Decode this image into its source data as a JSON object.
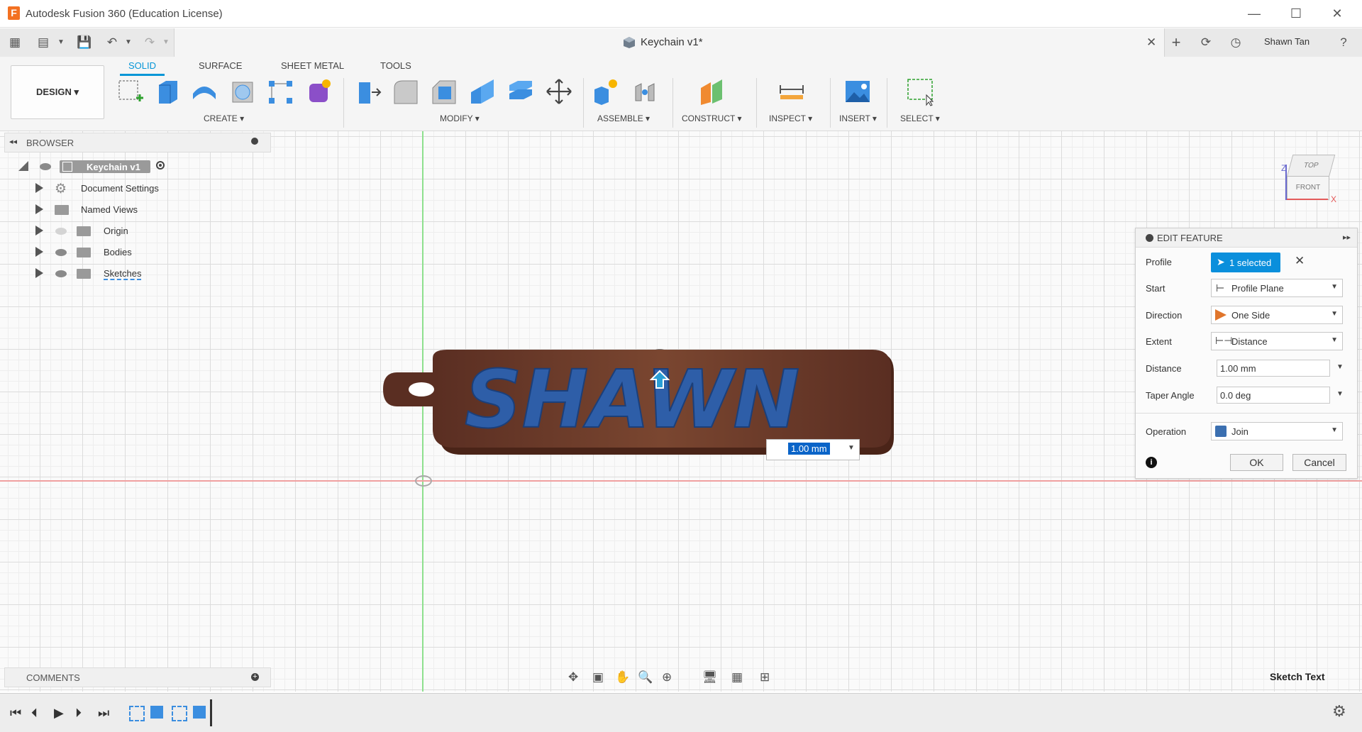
{
  "app": {
    "title": "Autodesk Fusion 360 (Education License)",
    "logo_letter": "F",
    "user": "Shawn Tan",
    "doc_title": "Keychain v1*"
  },
  "ribbon": {
    "tabs": [
      "SOLID",
      "SURFACE",
      "SHEET METAL",
      "TOOLS"
    ],
    "active_tab": "SOLID",
    "workspace": "DESIGN ▾",
    "groups": [
      "CREATE ▾",
      "MODIFY ▾",
      "ASSEMBLE ▾",
      "CONSTRUCT ▾",
      "INSPECT ▾",
      "INSERT ▾",
      "SELECT ▾"
    ]
  },
  "browser": {
    "title": "BROWSER",
    "root": "Keychain v1",
    "items": [
      "Document Settings",
      "Named Views",
      "Origin",
      "Bodies",
      "Sketches"
    ]
  },
  "viewcube": {
    "top": "TOP",
    "front": "FRONT",
    "axis_x": "X",
    "axis_z": "Z"
  },
  "model": {
    "text": "SHAWN",
    "dimension": "1.00 mm"
  },
  "edit_feature": {
    "title": "EDIT FEATURE",
    "rows": {
      "profile_label": "Profile",
      "profile_value": "1 selected",
      "start_label": "Start",
      "start_value": "Profile Plane",
      "direction_label": "Direction",
      "direction_value": "One Side",
      "extent_label": "Extent",
      "extent_value": "Distance",
      "distance_label": "Distance",
      "distance_value": "1.00 mm",
      "taper_label": "Taper Angle",
      "taper_value": "0.0 deg",
      "operation_label": "Operation",
      "operation_value": "Join"
    },
    "ok": "OK",
    "cancel": "Cancel"
  },
  "comments": {
    "title": "COMMENTS"
  },
  "status": {
    "hint": "Sketch Text"
  },
  "colors": {
    "accent": "#0696d7",
    "body": "#6b3b2c",
    "text_extrude": "#3e6fb5",
    "x_axis": "#e45b5b",
    "y_axis": "#7fd67f"
  }
}
